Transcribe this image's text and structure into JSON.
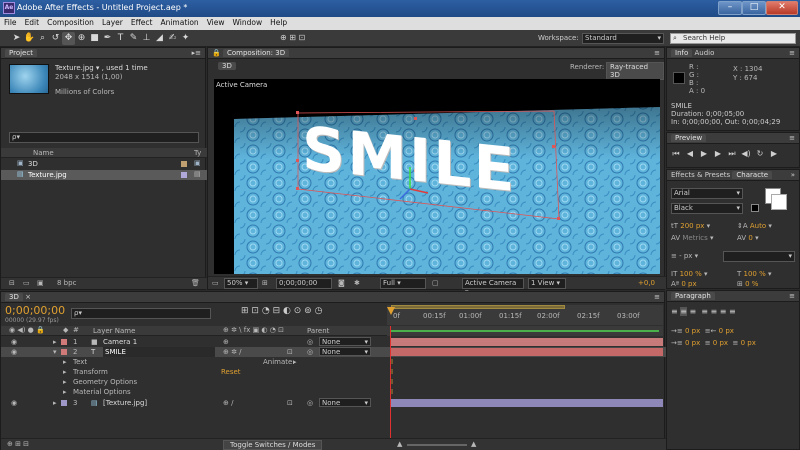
{
  "app": {
    "title": "Adobe After Effects - Untitled Project.aep *",
    "icon_label": "Ae"
  },
  "menu": [
    "File",
    "Edit",
    "Composition",
    "Layer",
    "Effect",
    "Animation",
    "View",
    "Window",
    "Help"
  ],
  "toolbar": {
    "workspace_label": "Workspace:",
    "workspace_value": "Standard",
    "search_placeholder": "Search Help"
  },
  "project": {
    "tab": "Project",
    "file_name": "Texture.jpg ▾ , used 1 time",
    "file_dims": "2048 x 1514 (1,00)",
    "file_colors": "Millions of Colors",
    "search_value": "ρ▾",
    "col_name": "Name",
    "col_type": "Ty",
    "items": [
      {
        "name": "3D",
        "color": "#c0a070"
      },
      {
        "name": "Texture.jpg",
        "color": "#b0a8d8"
      }
    ],
    "bpc": "8 bpc"
  },
  "composition": {
    "tab": "Composition: 3D",
    "comp_label": "3D",
    "renderer_label": "Renderer:",
    "renderer_value": "Ray-traced 3D",
    "view_label": "Active Camera",
    "text_content": "SMILE",
    "zoom": "50%",
    "timecode": "0;00;00;00",
    "resolution": "Full",
    "camera": "Active Camera",
    "views": "1 View",
    "exposure": "+0,0"
  },
  "info": {
    "tab": "Info",
    "tab_audio": "Audio",
    "r": "R :",
    "g": "G :",
    "b": "B :",
    "a": "A : 0",
    "x": "X : 1304",
    "y": "Y : 674",
    "layer": "SMILE",
    "duration": "Duration: 0;00;05;00",
    "inout": "In: 0;00;00;00, Out: 0;00;04;29"
  },
  "preview": {
    "tab": "Preview"
  },
  "character": {
    "tab_effects": "Effects & Presets",
    "tab_char": "Characte",
    "font": "Arial",
    "style": "Black",
    "size": "200 px",
    "leading": "Auto",
    "kerning": "Metrics",
    "tracking": "0",
    "stroke": "- px",
    "vscale": "100 %",
    "hscale": "100 %",
    "baseline": "0 px",
    "tsume": "0 %"
  },
  "paragraph": {
    "tab": "Paragraph",
    "v1": "0 px",
    "v2": "0 px",
    "v3": "0 px",
    "v4": "0 px",
    "v5": "0 px"
  },
  "timeline": {
    "tab": "3D",
    "timecode": "0;00;00;00",
    "frames": "00000 (29.97 fps)",
    "search_value": "ρ▾",
    "col_layer": "Layer Name",
    "col_parent": "Parent",
    "ruler": [
      "0f",
      "00:15f",
      "01:00f",
      "01:15f",
      "02:00f",
      "02:15f",
      "03:00f"
    ],
    "animate_label": "Animate:",
    "reset_label": "Reset",
    "layers": [
      {
        "num": "1",
        "name": "Camera 1",
        "parent": "None",
        "color": "#d07a7a",
        "bar": "#c77a7a"
      },
      {
        "num": "2",
        "name": "SMILE",
        "parent": "None",
        "color": "#d07a7a",
        "bar": "#c46868"
      },
      {
        "sub": "Text"
      },
      {
        "sub": "Transform"
      },
      {
        "sub": "Geometry Options"
      },
      {
        "sub": "Material Options"
      },
      {
        "num": "3",
        "name": "[Texture.jpg]",
        "parent": "None",
        "color": "#9e98c8",
        "bar": "#8e88b8"
      }
    ],
    "toggle_label": "Toggle Switches / Modes"
  }
}
